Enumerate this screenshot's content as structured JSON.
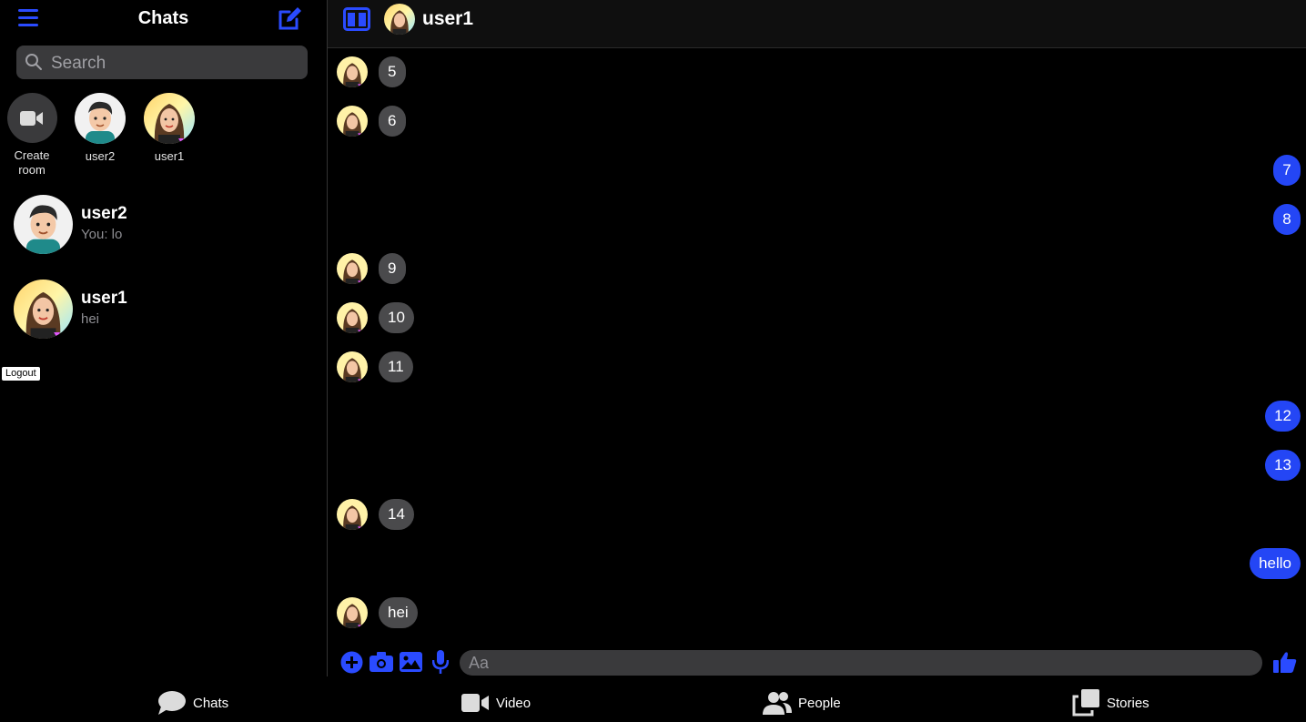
{
  "sidebar": {
    "title": "Chats",
    "search_placeholder": "Search",
    "stories": [
      {
        "label": "Create room"
      },
      {
        "label": "user2"
      },
      {
        "label": "user1"
      }
    ],
    "conversations": [
      {
        "name": "user2",
        "preview": "You: lo"
      },
      {
        "name": "user1",
        "preview": "hei"
      }
    ],
    "logout_label": "Logout"
  },
  "chat": {
    "contact_name": "user1",
    "messages": [
      {
        "direction": "in",
        "text": "5"
      },
      {
        "direction": "in",
        "text": "6"
      },
      {
        "direction": "out",
        "text": "7"
      },
      {
        "direction": "out",
        "text": "8"
      },
      {
        "direction": "in",
        "text": "9"
      },
      {
        "direction": "in",
        "text": "10"
      },
      {
        "direction": "in",
        "text": "11"
      },
      {
        "direction": "out",
        "text": "12"
      },
      {
        "direction": "out",
        "text": "13"
      },
      {
        "direction": "in",
        "text": "14"
      },
      {
        "direction": "out",
        "text": "hello"
      },
      {
        "direction": "in",
        "text": "hei"
      }
    ],
    "composer_placeholder": "Aa"
  },
  "nav": [
    {
      "label": "Chats",
      "icon": "chat-bubble-icon"
    },
    {
      "label": "Video",
      "icon": "video-camera-icon"
    },
    {
      "label": "People",
      "icon": "people-icon"
    },
    {
      "label": "Stories",
      "icon": "stories-icon"
    }
  ],
  "colors": {
    "accent": "#2446f5",
    "incoming_bubble": "#4a4a4c",
    "background": "#000000"
  }
}
